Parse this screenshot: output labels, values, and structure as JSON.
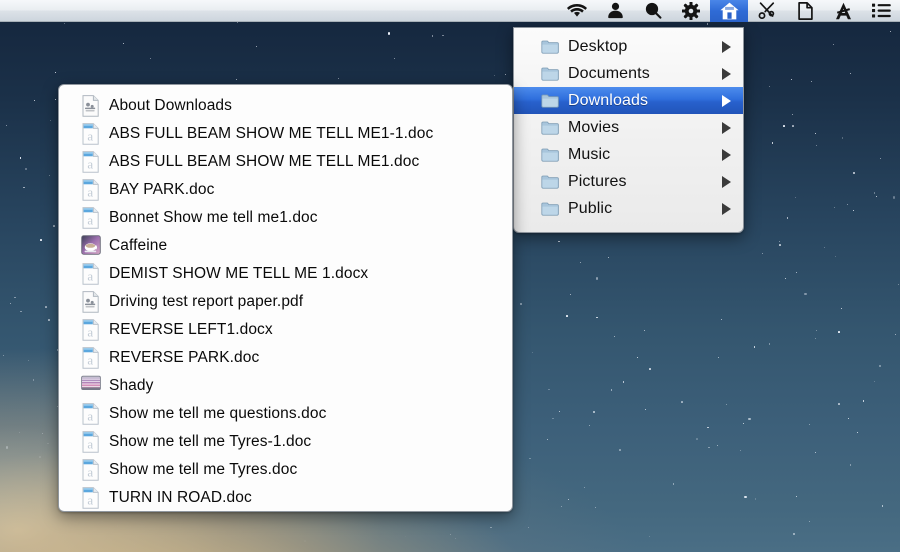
{
  "menubar": {
    "items": [
      {
        "name": "wifi-icon",
        "label": "Wi-Fi",
        "icon": "wifi",
        "selected": false
      },
      {
        "name": "user-icon",
        "label": "User",
        "icon": "person",
        "selected": false
      },
      {
        "name": "spotlight-icon",
        "label": "Spotlight",
        "icon": "search",
        "selected": false
      },
      {
        "name": "settings-icon",
        "label": "Settings",
        "icon": "gear",
        "selected": false
      },
      {
        "name": "home-folder-icon",
        "label": "Home",
        "icon": "house",
        "selected": true
      },
      {
        "name": "snippets-icon",
        "label": "Snippets",
        "icon": "scissors",
        "selected": false
      },
      {
        "name": "document-icon",
        "label": "Documents",
        "icon": "page",
        "selected": false
      },
      {
        "name": "appstore-icon",
        "label": "App Store",
        "icon": "letter-a",
        "selected": false
      },
      {
        "name": "list-icon",
        "label": "List",
        "icon": "list",
        "selected": false
      }
    ]
  },
  "folder_menu": {
    "items": [
      {
        "label": "Desktop",
        "selected": false,
        "has_submenu": true
      },
      {
        "label": "Documents",
        "selected": false,
        "has_submenu": true
      },
      {
        "label": "Downloads",
        "selected": true,
        "has_submenu": true
      },
      {
        "label": "Movies",
        "selected": false,
        "has_submenu": true
      },
      {
        "label": "Music",
        "selected": false,
        "has_submenu": true
      },
      {
        "label": "Pictures",
        "selected": false,
        "has_submenu": true
      },
      {
        "label": "Public",
        "selected": false,
        "has_submenu": true
      }
    ]
  },
  "file_list": {
    "items": [
      {
        "label": "About Downloads",
        "icon": "pdf-doc"
      },
      {
        "label": "ABS FULL BEAM SHOW ME TELL ME1-1.doc",
        "icon": "word-doc"
      },
      {
        "label": "ABS FULL BEAM SHOW ME TELL ME1.doc",
        "icon": "word-doc"
      },
      {
        "label": "BAY PARK.doc",
        "icon": "word-doc"
      },
      {
        "label": "Bonnet Show me tell me1.doc",
        "icon": "word-doc"
      },
      {
        "label": "Caffeine",
        "icon": "caffeine-app"
      },
      {
        "label": "DEMIST SHOW ME TELL ME 1.docx",
        "icon": "word-doc"
      },
      {
        "label": "Driving test report paper.pdf",
        "icon": "pdf-doc"
      },
      {
        "label": "REVERSE LEFT1.docx",
        "icon": "word-doc"
      },
      {
        "label": "REVERSE PARK.doc",
        "icon": "word-doc"
      },
      {
        "label": "Shady",
        "icon": "shady-app"
      },
      {
        "label": "Show me tell me questions.doc",
        "icon": "word-doc"
      },
      {
        "label": "Show me tell me Tyres-1.doc",
        "icon": "word-doc"
      },
      {
        "label": "Show me tell me Tyres.doc",
        "icon": "word-doc"
      },
      {
        "label": "TURN IN ROAD.doc",
        "icon": "word-doc"
      }
    ]
  },
  "colors": {
    "selection_blue": "#2f6fdd",
    "menubar_bg": "#e9edf1",
    "panel_bg": "#fdfdfd",
    "folder_icon": "#a9c6dd"
  }
}
